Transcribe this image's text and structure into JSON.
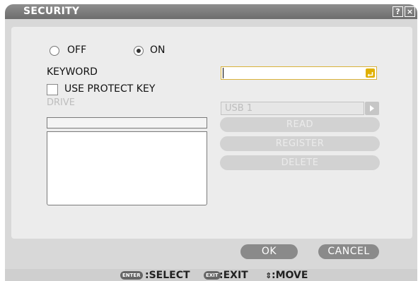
{
  "window": {
    "title": "SECURITY",
    "help_label": "?",
    "close_label": "×"
  },
  "security": {
    "off_label": "OFF",
    "on_label": "ON",
    "selected": "ON",
    "keyword_label": "KEYWORD",
    "keyword_value": "",
    "use_protect_key_label": "USE PROTECT KEY",
    "use_protect_key_checked": false,
    "drive_label": "DRIVE",
    "usb_value": "USB 1",
    "read_label": "READ",
    "register_label": "REGISTER",
    "delete_label": "DELETE"
  },
  "footer": {
    "ok_label": "OK",
    "cancel_label": "CANCEL"
  },
  "status": {
    "enter_key": "ENTER",
    "select_label": ":SELECT",
    "exit_key": "EXIT",
    "exit_label": ":EXIT",
    "move_label": ":MOVE"
  },
  "colors": {
    "titlebar": "#7a7a7a",
    "keyword_border": "#d9b23a",
    "enter_icon": "#e0b000"
  }
}
